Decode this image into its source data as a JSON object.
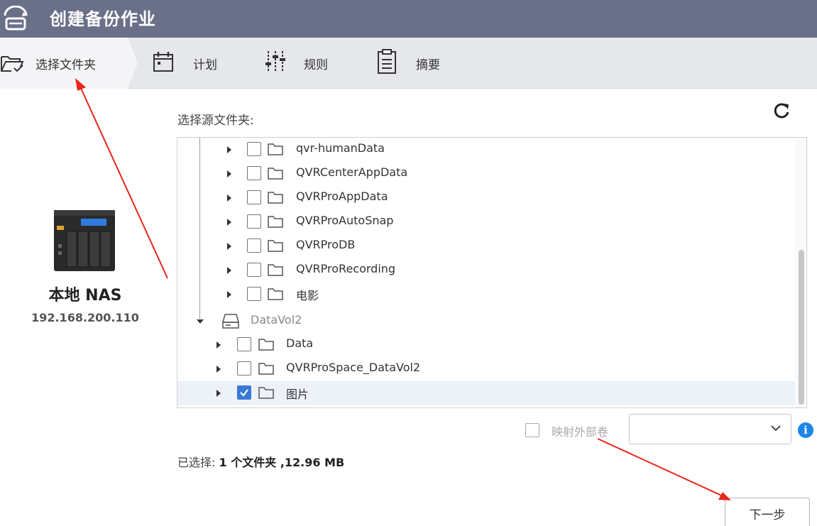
{
  "window": {
    "title": "创建备份作业"
  },
  "steps": [
    {
      "label": "选择文件夹",
      "icon": "folder-check-icon",
      "active": true
    },
    {
      "label": "计划",
      "icon": "calendar-icon",
      "active": false
    },
    {
      "label": "规则",
      "icon": "sliders-icon",
      "active": false
    },
    {
      "label": "摘要",
      "icon": "clipboard-icon",
      "active": false
    }
  ],
  "nas": {
    "name": "本地 NAS",
    "ip": "192.168.200.110"
  },
  "source": {
    "label": "选择源文件夹:"
  },
  "tree": {
    "items": [
      {
        "label": "qvr-humanData",
        "checked": false
      },
      {
        "label": "QVRCenterAppData",
        "checked": false
      },
      {
        "label": "QVRProAppData",
        "checked": false
      },
      {
        "label": "QVRProAutoSnap",
        "checked": false
      },
      {
        "label": "QVRProDB",
        "checked": false
      },
      {
        "label": "QVRProRecording",
        "checked": false
      },
      {
        "label": "电影",
        "checked": false
      }
    ],
    "volume": {
      "label": "DataVol2"
    },
    "vol_items": [
      {
        "label": "Data",
        "checked": false
      },
      {
        "label": "QVRProSpace_DataVol2",
        "checked": false
      },
      {
        "label": "图片",
        "checked": true
      }
    ]
  },
  "map_external": {
    "label": "映射外部卷",
    "checked": false,
    "select_value": ""
  },
  "summary": {
    "prefix": "已选择:",
    "value": "1 个文件夹 ,12.96 MB"
  },
  "buttons": {
    "next": "下一步"
  },
  "colors": {
    "titlebar": "#6b7089",
    "accent": "#3a78d6",
    "info": "#1d86e8",
    "annotation": "#e8261c"
  }
}
